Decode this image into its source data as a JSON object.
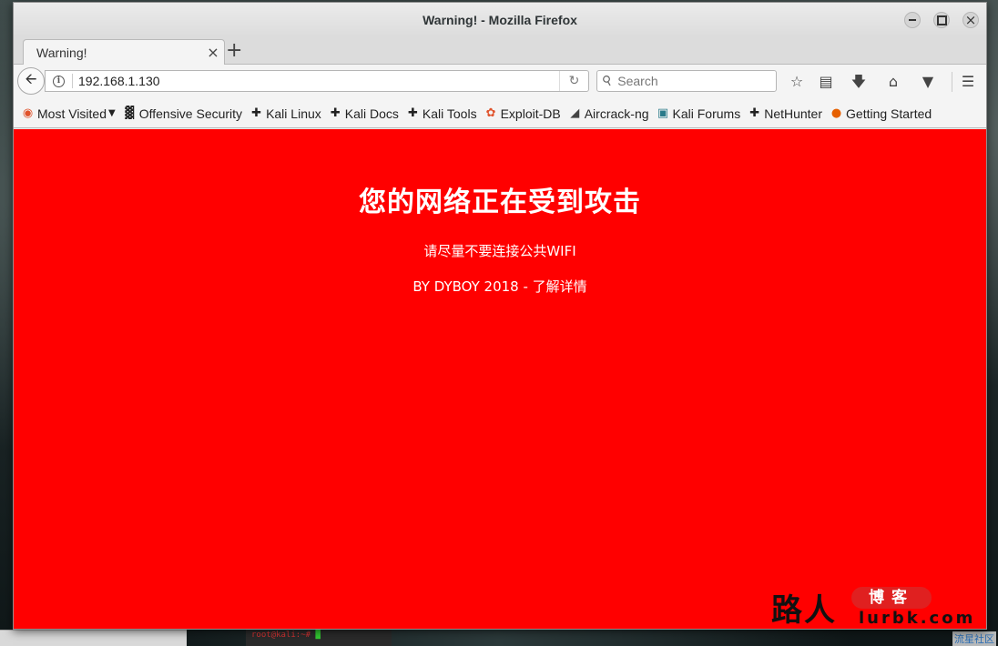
{
  "window": {
    "title": "Warning! - Mozilla Firefox"
  },
  "tab": {
    "title": "Warning!",
    "close": "×",
    "new_tab": "+"
  },
  "navbar": {
    "url": "192.168.1.130",
    "search_placeholder": "Search"
  },
  "bookmarks": [
    {
      "label": "Most Visited",
      "icon": "most-visited-icon",
      "icon_color": "#e0532c"
    },
    {
      "label": "Offensive Security",
      "icon": "offsec-icon",
      "icon_color": "#222222"
    },
    {
      "label": "Kali Linux",
      "icon": "kali-dragon-icon",
      "icon_color": "#222222"
    },
    {
      "label": "Kali Docs",
      "icon": "kali-dragon-icon",
      "icon_color": "#222222"
    },
    {
      "label": "Kali Tools",
      "icon": "kali-dragon-icon",
      "icon_color": "#222222"
    },
    {
      "label": "Exploit-DB",
      "icon": "exploit-db-icon",
      "icon_color": "#e0532c"
    },
    {
      "label": "Aircrack-ng",
      "icon": "aircrack-icon",
      "icon_color": "#444444"
    },
    {
      "label": "Kali Forums",
      "icon": "kali-forums-icon",
      "icon_color": "#2a7a8a"
    },
    {
      "label": "NetHunter",
      "icon": "kali-dragon-icon",
      "icon_color": "#222222"
    },
    {
      "label": "Getting Started",
      "icon": "firefox-icon",
      "icon_color": "#e66000"
    }
  ],
  "page": {
    "headline": "您的网络正在受到攻击",
    "line1": "请尽量不要连接公共WIFI",
    "line2": "BY DYBOY 2018 - 了解详情",
    "background": "#ff0000"
  },
  "watermark": {
    "big": "路人",
    "pill": "博客",
    "domain": "lurbk.com"
  },
  "desktop": {
    "corner_text": "流星社区"
  }
}
